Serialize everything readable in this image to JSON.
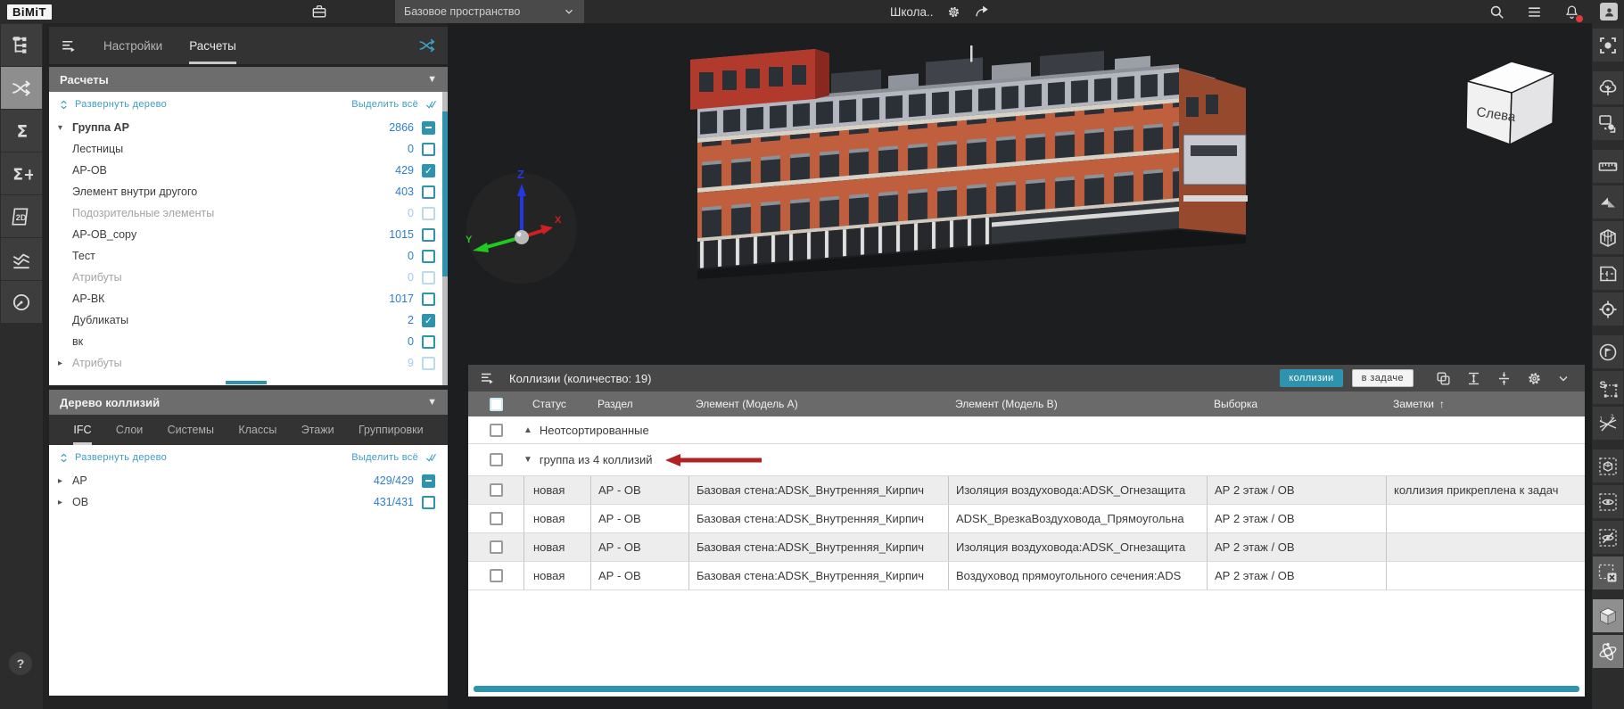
{
  "colors": {
    "accent_teal": "#2e93ac",
    "link_teal": "#3f9ec2",
    "count_blue": "#2d7dd2",
    "arrow_red": "#b22222",
    "notification_red": "#e03b3b"
  },
  "topbar": {
    "logo": "BiMiT",
    "workspace_label": "Базовое пространство",
    "project_title": "Школа..",
    "project_icons": [
      "settings-gear-icon",
      "share-icon"
    ],
    "right_icons": [
      {
        "name": "search-icon"
      },
      {
        "name": "menu-list-icon"
      },
      {
        "name": "notifications-icon",
        "badge": true
      },
      {
        "name": "profile-icon",
        "avatar": true
      }
    ]
  },
  "left_toolbar": {
    "items": [
      {
        "name": "model-tree-icon",
        "active": false
      },
      {
        "name": "collision-check-icon",
        "active": true
      },
      {
        "name": "sum-icon",
        "active": false
      },
      {
        "name": "sum-plus-icon",
        "active": false
      },
      {
        "name": "2d-icon",
        "active": false
      },
      {
        "name": "graphs-icon",
        "active": false
      },
      {
        "name": "dashboard-icon",
        "active": false
      }
    ]
  },
  "panel": {
    "tabs": [
      {
        "label": "Настройки",
        "active": false
      },
      {
        "label": "Расчеты",
        "active": true
      }
    ],
    "calc": {
      "title": "Расчеты",
      "expand_label": "Развернуть дерево",
      "select_all_label": "Выделить всё",
      "rows": [
        {
          "label": "Группа АР",
          "count": "2866",
          "state": "indeterminate",
          "bold": true,
          "caret": "down"
        },
        {
          "label": "Лестницы",
          "count": "0",
          "state": "unchecked"
        },
        {
          "label": "АР-ОВ",
          "count": "429",
          "state": "checked"
        },
        {
          "label": "Элемент внутри другого",
          "count": "403",
          "state": "unchecked"
        },
        {
          "label": "Подозрительные элементы",
          "count": "0",
          "state": "unchecked",
          "disabled": true
        },
        {
          "label": "АР-ОВ_copy",
          "count": "1015",
          "state": "unchecked"
        },
        {
          "label": "Тест",
          "count": "0",
          "state": "unchecked"
        },
        {
          "label": "Атрибуты",
          "count": "0",
          "state": "unchecked",
          "disabled": true
        },
        {
          "label": "АР-ВК",
          "count": "1017",
          "state": "unchecked"
        },
        {
          "label": "Дубликаты",
          "count": "2",
          "state": "checked"
        },
        {
          "label": "вк",
          "count": "0",
          "state": "unchecked"
        },
        {
          "label": "Атрибуты",
          "count": "9",
          "state": "unchecked",
          "disabled": true,
          "caret": "right"
        }
      ]
    },
    "tree": {
      "title": "Дерево коллизий",
      "tabs": [
        "IFC",
        "Слои",
        "Системы",
        "Классы",
        "Этажи",
        "Группировки"
      ],
      "active_tab": "IFC",
      "expand_label": "Развернуть дерево",
      "select_all_label": "Выделить всё",
      "rows": [
        {
          "label": "АР",
          "count": "429/429",
          "state": "indeterminate",
          "caret": "right"
        },
        {
          "label": "ОВ",
          "count": "431/431",
          "state": "unchecked",
          "caret": "right"
        }
      ]
    }
  },
  "viewport": {
    "view_cube_label": "Слева",
    "axes": {
      "x": "X",
      "y": "Y",
      "z": "Z"
    }
  },
  "collisions": {
    "title": "Коллизии (количество: 19)",
    "buttons": [
      {
        "label": "коллизии",
        "active": true
      },
      {
        "label": "в задаче",
        "active": false
      }
    ],
    "toolbar_icons": [
      "copy-icon",
      "rows-expand-icon",
      "rows-collapse-icon",
      "settings-gear-icon",
      "chevron-down-icon"
    ],
    "columns": [
      "Статус",
      "Раздел",
      "Элемент (Модель A)",
      "Элемент (Модель B)",
      "Выборка",
      "Заметки"
    ],
    "sorted_column": "Заметки",
    "sort_icon": "↑",
    "groups": [
      {
        "label": "Неотсортированные",
        "collapsed": true
      },
      {
        "label": "группа из 4 коллизий",
        "collapsed": false,
        "pointer_arrow": true
      }
    ],
    "rows": [
      {
        "status": "новая",
        "section": "АР - ОВ",
        "elem_a": "Базовая стена:ADSK_Внутренняя_Кирпич",
        "elem_b": "Изоляция воздуховода:ADSK_Огнезащита",
        "selection": "АР 2 этаж / ОВ",
        "notes": "коллизия прикреплена к задач"
      },
      {
        "status": "новая",
        "section": "АР - ОВ",
        "elem_a": "Базовая стена:ADSK_Внутренняя_Кирпич",
        "elem_b": "ADSK_ВрезкаВоздуховода_Прямоугольна",
        "selection": "АР 2 этаж / ОВ",
        "notes": ""
      },
      {
        "status": "новая",
        "section": "АР - ОВ",
        "elem_a": "Базовая стена:ADSK_Внутренняя_Кирпич",
        "elem_b": "Изоляция воздуховода:ADSK_Огнезащита",
        "selection": "АР 2 этаж / ОВ",
        "notes": ""
      },
      {
        "status": "новая",
        "section": "АР - ОВ",
        "elem_a": "Базовая стена:ADSK_Внутренняя_Кирпич",
        "elem_b": "Воздуховод прямоугольного сечения:ADS",
        "selection": "АР 2 этаж / ОВ",
        "notes": ""
      }
    ]
  },
  "right_toolbar": {
    "items": [
      {
        "name": "fit-view-icon"
      },
      {
        "name": "tree-icon"
      },
      {
        "name": "multi-select-icon"
      },
      {
        "name": "measure-icon"
      },
      {
        "name": "clip-plane-icon"
      },
      {
        "name": "section-box-icon"
      },
      {
        "name": "floorplan-icon"
      },
      {
        "name": "locate-icon"
      },
      {
        "name": "issue-flag-icon"
      },
      {
        "name": "selection-save-icon"
      },
      {
        "name": "collision-pair-icon"
      },
      {
        "name": "isolate-box-icon"
      },
      {
        "name": "show-selection-icon"
      },
      {
        "name": "hide-selection-icon"
      },
      {
        "name": "clear-selection-icon",
        "state": "hl"
      },
      {
        "name": "solid-cube-icon",
        "state": "act"
      },
      {
        "name": "orbit-icon",
        "state": "act2"
      }
    ]
  },
  "help_label": "?"
}
